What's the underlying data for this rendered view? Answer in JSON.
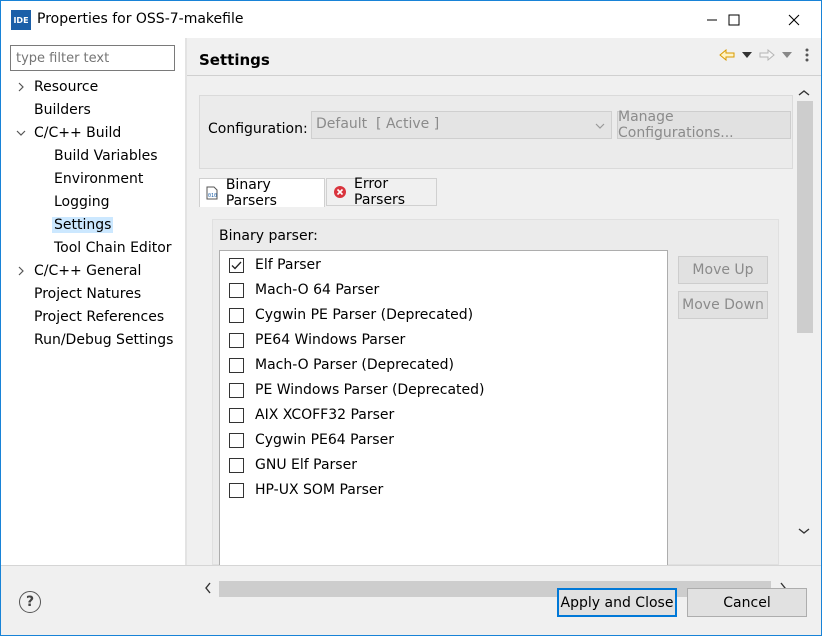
{
  "window": {
    "app_icon_text": "IDE",
    "title": "Properties for OSS-7-makefile"
  },
  "sidebar": {
    "filter_placeholder": "type filter text",
    "items": [
      {
        "label": "Resource",
        "expandable": true,
        "expanded": false,
        "level": 0
      },
      {
        "label": "Builders",
        "expandable": false,
        "level": 0
      },
      {
        "label": "C/C++ Build",
        "expandable": true,
        "expanded": true,
        "level": 0
      },
      {
        "label": "Build Variables",
        "expandable": false,
        "level": 1
      },
      {
        "label": "Environment",
        "expandable": false,
        "level": 1
      },
      {
        "label": "Logging",
        "expandable": false,
        "level": 1
      },
      {
        "label": "Settings",
        "expandable": false,
        "level": 1,
        "selected": true
      },
      {
        "label": "Tool Chain Editor",
        "expandable": false,
        "level": 1
      },
      {
        "label": "C/C++ General",
        "expandable": true,
        "expanded": false,
        "level": 0
      },
      {
        "label": "Project Natures",
        "expandable": false,
        "level": 0
      },
      {
        "label": "Project References",
        "expandable": false,
        "level": 0
      },
      {
        "label": "Run/Debug Settings",
        "expandable": false,
        "level": 0
      }
    ]
  },
  "main": {
    "title": "Settings",
    "configuration_label": "Configuration:",
    "configuration_value": "Default  [ Active ]",
    "manage_button": "Manage Configurations...",
    "tabs": [
      {
        "label": "Binary Parsers",
        "active": true
      },
      {
        "label": "Error Parsers",
        "active": false
      }
    ],
    "binary_parser_label": "Binary parser:",
    "parsers": [
      {
        "label": "Elf Parser",
        "checked": true
      },
      {
        "label": "Mach-O 64 Parser",
        "checked": false
      },
      {
        "label": "Cygwin PE Parser (Deprecated)",
        "checked": false
      },
      {
        "label": "PE64 Windows Parser",
        "checked": false
      },
      {
        "label": "Mach-O Parser (Deprecated)",
        "checked": false
      },
      {
        "label": "PE Windows Parser (Deprecated)",
        "checked": false
      },
      {
        "label": "AIX XCOFF32 Parser",
        "checked": false
      },
      {
        "label": "Cygwin PE64 Parser",
        "checked": false
      },
      {
        "label": "GNU Elf Parser",
        "checked": false
      },
      {
        "label": "HP-UX SOM Parser",
        "checked": false
      }
    ],
    "move_up": "Move Up",
    "move_down": "Move Down"
  },
  "footer": {
    "help_symbol": "?",
    "apply_close": "Apply and Close",
    "cancel": "Cancel"
  },
  "colors": {
    "accent": "#0078d7",
    "selection": "#cce8ff",
    "nav_back": "#e6a700",
    "error_icon": "#d9343d"
  }
}
